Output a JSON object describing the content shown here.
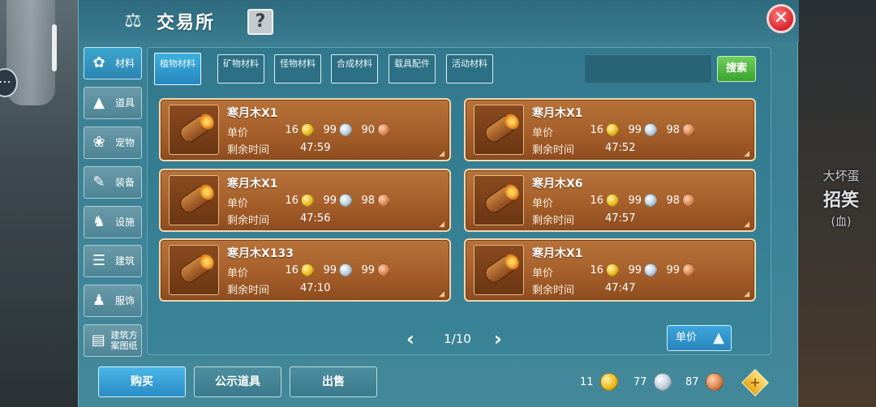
{
  "background": {
    "npc_lines": [
      "大坏蛋",
      "招笑",
      "(⾎)"
    ]
  },
  "window": {
    "title": "交易所",
    "help_label": "?",
    "close_label": "✕"
  },
  "sidebar": {
    "items": [
      {
        "label": "材料",
        "icon": "flower-cluster-icon"
      },
      {
        "label": "道具",
        "icon": "cone-item-icon"
      },
      {
        "label": "宠物",
        "icon": "paw-icon"
      },
      {
        "label": "装备",
        "icon": "equipment-icon"
      },
      {
        "label": "设施",
        "icon": "facility-icon"
      },
      {
        "label": "建筑",
        "icon": "building-icon"
      },
      {
        "label": "服饰",
        "icon": "clothing-icon"
      },
      {
        "label": "建筑方案图纸",
        "icon": "blueprint-icon"
      }
    ]
  },
  "tabs": [
    {
      "label": "植物材料"
    },
    {
      "label": "矿物材料"
    },
    {
      "label": "怪物材料"
    },
    {
      "label": "合成材料"
    },
    {
      "label": "载具配件"
    },
    {
      "label": "活动材料"
    }
  ],
  "search": {
    "value": "",
    "button_label": "搜索"
  },
  "labels": {
    "unit_price": "单价",
    "remaining_time": "剩余时间"
  },
  "listings": [
    {
      "name": "寒月木X1",
      "gold": "16",
      "silver": "99",
      "copper": "90",
      "time": "47:59"
    },
    {
      "name": "寒月木X1",
      "gold": "16",
      "silver": "99",
      "copper": "98",
      "time": "47:52"
    },
    {
      "name": "寒月木X1",
      "gold": "16",
      "silver": "99",
      "copper": "98",
      "time": "47:56"
    },
    {
      "name": "寒月木X6",
      "gold": "16",
      "silver": "99",
      "copper": "98",
      "time": "47:57"
    },
    {
      "name": "寒月木X133",
      "gold": "16",
      "silver": "99",
      "copper": "99",
      "time": "47:10"
    },
    {
      "name": "寒月木X1",
      "gold": "16",
      "silver": "99",
      "copper": "99",
      "time": "47:47"
    }
  ],
  "pagination": {
    "text": "1/10",
    "prev": "‹",
    "next": "›"
  },
  "sort": {
    "label": "单价",
    "arrow": "▲"
  },
  "bottom": {
    "buy": "购买",
    "public": "公示道具",
    "sell": "出售"
  },
  "wallet": {
    "gold": "11",
    "silver": "77",
    "copper": "87",
    "add_label": "+"
  },
  "colors": {
    "panel": "#3b8095",
    "active_tab": "#2b95cf",
    "listing_card": "#a65f2a",
    "search_button": "#3aa230",
    "close_button": "#d8242b"
  }
}
